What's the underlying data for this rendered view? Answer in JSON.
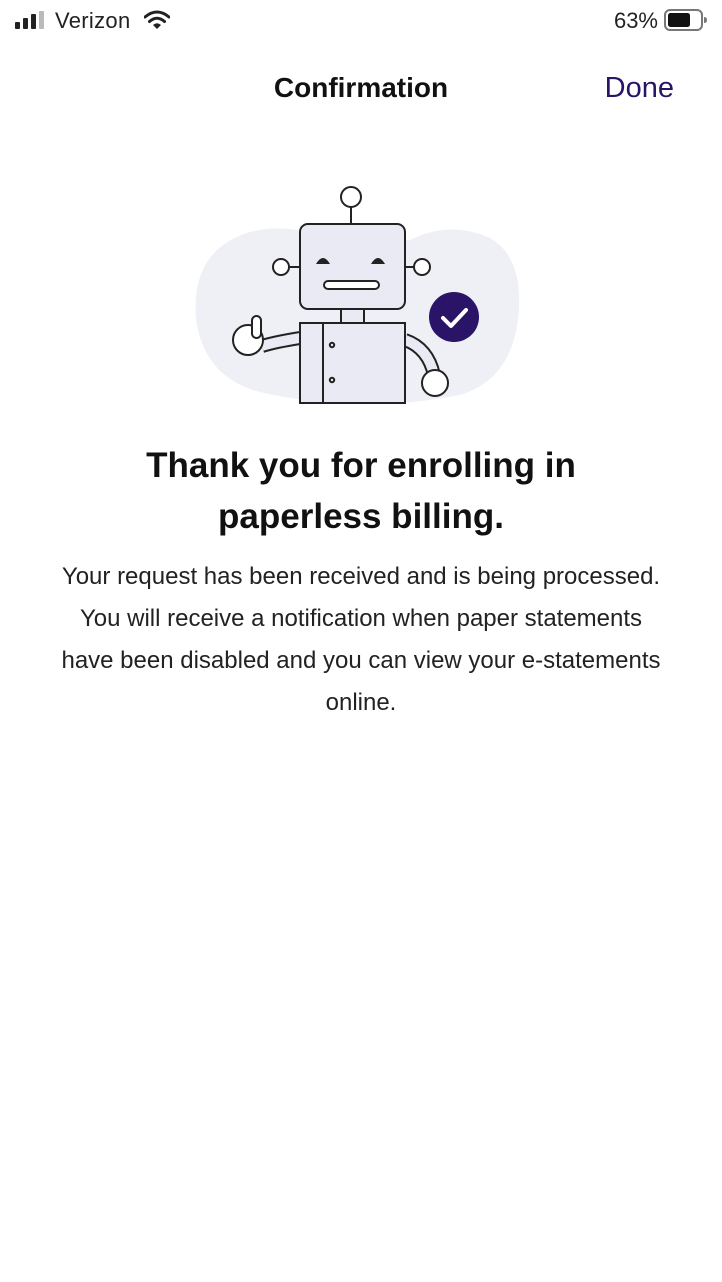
{
  "status_bar": {
    "carrier": "Verizon",
    "battery_percent": "63%",
    "icons": [
      "signal-bars-icon",
      "wifi-icon",
      "battery-icon"
    ]
  },
  "nav": {
    "title": "Confirmation",
    "done_label": "Done"
  },
  "illustration": {
    "icon": "robot-thumbs-up-icon",
    "badge_icon": "checkmark-circle-icon"
  },
  "content": {
    "headline": "Thank you for enrolling in paperless billing.",
    "message": "Your request has been received and is being processed. You will receive a notification when paper statements have been disabled and you can view your e-statements online."
  },
  "colors": {
    "accent": "#2a1468",
    "blob": "#eef0f6",
    "robot_fill": "#e9eaf3",
    "outline": "#222222"
  }
}
